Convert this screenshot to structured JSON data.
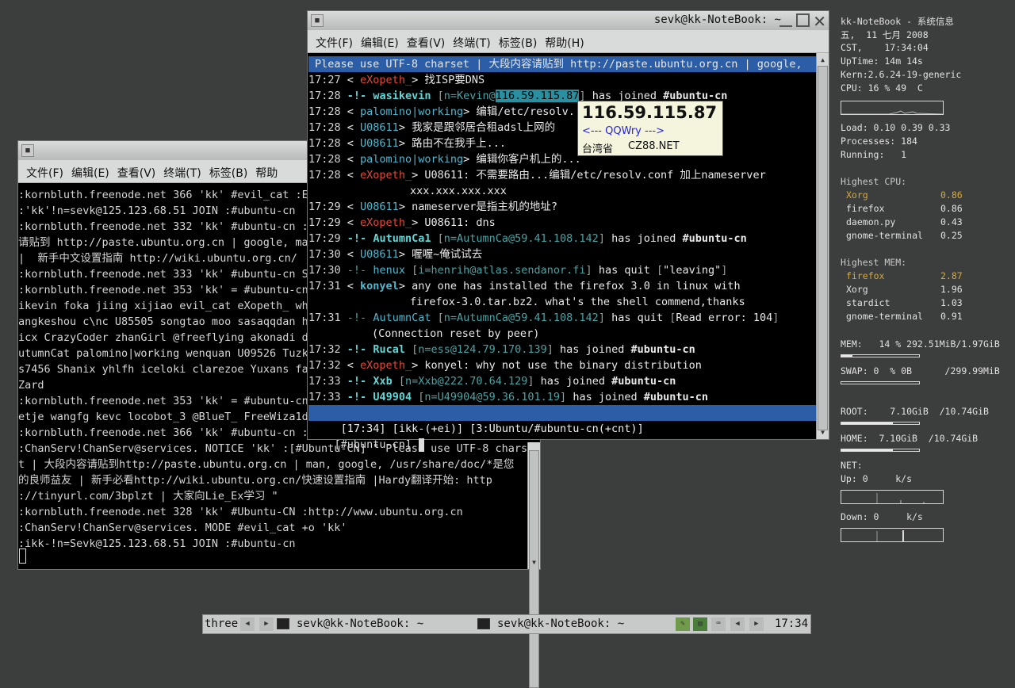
{
  "back_window": {
    "menu": [
      "文件(F)",
      "编辑(E)",
      "查看(V)",
      "终端(T)",
      "标签(B)",
      "帮助"
    ],
    "lines": [
      ":kornbluth.freenode.net 366 'kk' #evil_cat :En",
      ":'kk'!n=sevk@125.123.68.51 JOIN :#ubuntu-cn",
      ":kornbluth.freenode.net 332 'kk' #ubuntu-cn :P",
      "请贴到 http://paste.ubuntu.org.cn | google, ma",
      "|  新手中文设置指南 http://wiki.ubuntu.org.cn/",
      ":kornbluth.freenode.net 333 'kk' #ubuntu-cn SP",
      ":kornbluth.freenode.net 353 'kk' = #ubuntu-cn ",
      "ikevin foka jiing xijiao evil_cat eXopeth_ wha",
      "angkeshou c\\nc U85505 songtao moo sasaqqdan he",
      "icx CrazyCoder zhanGirl @freeflying akonadi dz",
      "utumnCat palomino|working wenquan U09526 Tuzk",
      "s7456 Shanix yhlfh iceloki clarezoe Yuxans far",
      "Zard",
      ":kornbluth.freenode.net 353 'kk' = #ubuntu-cn ",
      "etje wangfg kevc locobot_3 @BlueT_ FreeWiza1d ",
      ":kornbluth.freenode.net 366 'kk' #ubuntu-cn :E",
      ":ChanServ!ChanServ@services. NOTICE 'kk' :[#Ubuntu-CN] \" Please use UTF-8 charse",
      "t | 大段内容请贴到http://paste.ubuntu.org.cn | man, google, /usr/share/doc/*是您",
      "的良师益友 | 新手必看http://wiki.ubuntu.org.cn/快速设置指南 |Hardy翻译开始: http",
      "://tinyurl.com/3bplzt | 大家向Lie_Ex学习 \"",
      ":kornbluth.freenode.net 328 'kk' #Ubuntu-CN :http://www.ubuntu.org.cn",
      ":ChanServ!ChanServ@services. MODE #evil_cat +o 'kk'",
      ":ikk-!n=Sevk@125.123.68.51 JOIN :#ubuntu-cn"
    ]
  },
  "front_window": {
    "title": "sevk@kk-NoteBook: ~",
    "menu": [
      "文件(F)",
      "编辑(E)",
      "查看(V)",
      "终端(T)",
      "标签(B)",
      "帮助(H)"
    ],
    "topic": "Please use UTF-8 charset | 大段内容请贴到 http://paste.ubuntu.org.cn | google,",
    "messages": [
      {
        "time": "17:27",
        "nick": "eXopeth_",
        "text": "找ISP要DNS"
      },
      {
        "time": "17:28",
        "join": "wasikevin",
        "host_pre": "n=Kevin@",
        "host_ip": "116.59.115.87",
        "msg": "has joined",
        "chan": "#ubuntu-cn"
      },
      {
        "time": "17:28",
        "nick": "palomino|working",
        "text": "编辑/etc/resolv."
      },
      {
        "time": "17:28",
        "nick": "U08611",
        "text": "我家是跟邻居合租adsl上网的"
      },
      {
        "time": "17:28",
        "nick": "U08611",
        "text": "路由不在我手上..."
      },
      {
        "time": "17:28",
        "nick": "palomino|working",
        "text": "编辑你客户机上的..."
      },
      {
        "time": "17:28",
        "nick": "eXopeth_",
        "text": "U08611: 不需要路由...编辑/etc/resolv.conf 加上nameserver",
        "cont": "xxx.xxx.xxx.xxx"
      },
      {
        "time": "17:29",
        "nick": "U08611",
        "text": "nameserver是指主机的地址?"
      },
      {
        "time": "17:29",
        "nick": "eXopeth_",
        "text": "U08611: dns"
      },
      {
        "time": "17:29",
        "join": "AutumnCa1",
        "host": "n=AutumnCa@59.41.108.142",
        "msg": "has joined",
        "chan": "#ubuntu-cn"
      },
      {
        "time": "17:30",
        "nick": "U08611",
        "text": "喔喔~俺试试去"
      },
      {
        "time": "17:30",
        "quit": "henux",
        "host": "i=henrih@atlas.sendanor.fi",
        "msg": "has quit",
        "reason": "\"leaving\""
      },
      {
        "time": "17:31",
        "nick": "konyel",
        "text": "any one has installed the firefox 3.0 in linux with",
        "cont": "firefox-3.0.tar.bz2. what's the shell commend,thanks"
      },
      {
        "time": "17:31",
        "quit": "AutumnCat",
        "host": "n=AutumnCa@59.41.108.142",
        "msg": "has quit",
        "reason": "Read error: 104",
        "cont": "(Connection reset by peer)"
      },
      {
        "time": "17:32",
        "join": "Rucal",
        "host": "n=ess@124.79.170.139",
        "msg": "has joined",
        "chan": "#ubuntu-cn"
      },
      {
        "time": "17:32",
        "nick": "eXopeth_",
        "text": "konyel: why not use the binary distribution"
      },
      {
        "time": "17:33",
        "join": "Xxb",
        "host": "n=Xxb@222.70.64.129",
        "msg": "has joined",
        "chan": "#ubuntu-cn"
      },
      {
        "time": "17:33",
        "join": "U49904",
        "host": "n=U49904@59.36.101.19",
        "msg": "has joined",
        "chan": "#ubuntu-cn"
      }
    ],
    "status": {
      "time": "17:34",
      "nick": "ikk-(+ei)",
      "window": "3:Ubuntu/#ubuntu-cn(+cnt)"
    },
    "prompt": "[#ubuntu-cn]"
  },
  "tooltip": {
    "ip": "116.59.115.87",
    "link": "<--- QQWry --->",
    "loc": "台湾省",
    "src": "CZ88.NET"
  },
  "sysinfo": {
    "title": "kk-NoteBook - 系统信息",
    "date": "五,  11 七月 2008",
    "time": "CST,    17:34:04",
    "uptime": "UpTime: 14m 14s",
    "kern": "Kern:2.6.24-19-generic",
    "cpu": "CPU: 16 % 49  C",
    "load": "Load: 0.10 0.39 0.33",
    "processes": "Processes: 184",
    "running": "Running:   1",
    "highest_cpu_label": "Highest CPU:",
    "highest_cpu": [
      [
        "Xorg",
        "0.86"
      ],
      [
        "firefox",
        "0.86"
      ],
      [
        "daemon.py",
        "0.43"
      ],
      [
        "gnome-terminal",
        "0.25"
      ]
    ],
    "highest_mem_label": "Highest MEM:",
    "highest_mem": [
      [
        "firefox",
        "2.87"
      ],
      [
        "Xorg",
        "1.96"
      ],
      [
        "stardict",
        "1.03"
      ],
      [
        "gnome-terminal",
        "0.91"
      ]
    ],
    "mem": "MEM:   14 % 292.51MiB/1.97GiB",
    "mem_pct": 14,
    "swap": "SWAP: 0  % 0B      /299.99MiB",
    "swap_pct": 0,
    "root": "ROOT:    7.10GiB  /10.74GiB",
    "root_pct": 66,
    "home": "HOME:  7.10GiB  /10.74GiB",
    "home_pct": 66,
    "net": "NET:",
    "up": "Up: 0     k/s",
    "down": "Down: 0     k/s"
  },
  "taskbar": {
    "workspace": "three",
    "tasks": [
      "sevk@kk-NoteBook: ~",
      "sevk@kk-NoteBook: ~"
    ],
    "clock": "17:34"
  },
  "colors": {
    "desktop": "#3b3e3c",
    "join": "#5fd7d7",
    "nick_red": "#e24a3c",
    "nick_cyan": "#4fb8cf",
    "status_bar": "#2c5ea8",
    "gold": "#d9a93a"
  }
}
